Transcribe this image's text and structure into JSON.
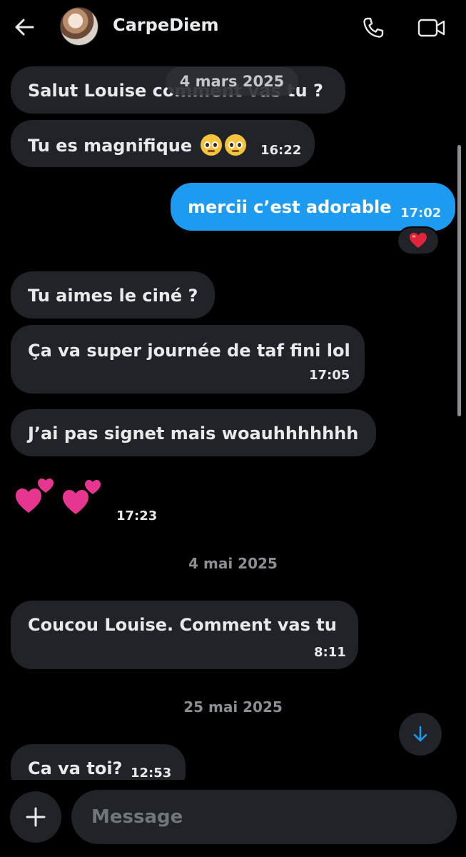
{
  "header": {
    "contact_name": "CarpeDiem"
  },
  "floating_date": "4 mars 2025",
  "messages": [
    {
      "text": "Salut Louise comment vas tu ?"
    },
    {
      "text": "Tu es magnifique",
      "emojis": [
        "pleading-face",
        "pleading-face"
      ],
      "time": "16:22"
    },
    {
      "text": "mercii c’est adorable",
      "time": "17:02",
      "sent": true,
      "reaction": "red-heart"
    },
    {
      "text": "Tu aimes le ciné ?"
    },
    {
      "text": "Ça va super journée de taf fini lol",
      "time": "17:05"
    },
    {
      "text": "J’ai pas signet mais woauhhhhhhh"
    },
    {
      "emojis": [
        "two-hearts",
        "two-hearts"
      ],
      "time": "17:23"
    },
    {
      "text": "Coucou Louise. Comment vas tu",
      "time": "8:11"
    },
    {
      "text": "Ca va toi?",
      "time": "12:53"
    }
  ],
  "date_separators": [
    "4 mai 2025",
    "25 mai 2025"
  ],
  "composer": {
    "placeholder": "Message"
  },
  "colors": {
    "background": "#000000",
    "received_bubble": "#202327",
    "sent_bubble": "#1d9bf0",
    "muted_text": "#8b8f94"
  }
}
